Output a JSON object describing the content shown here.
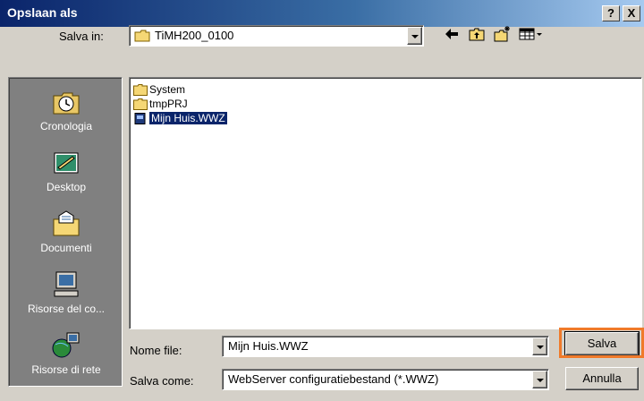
{
  "window": {
    "title": "Opslaan als",
    "help_button": "?",
    "close_button": "X"
  },
  "lookin": {
    "label": "Salva in:",
    "value": "TiMH200_0100"
  },
  "toolbar": {
    "icons": [
      "back-arrow-icon",
      "up-folder-icon",
      "new-folder-icon",
      "view-menu-icon"
    ]
  },
  "places": [
    {
      "label": "Cronologia",
      "icon": "history-icon"
    },
    {
      "label": "Desktop",
      "icon": "desktop-icon"
    },
    {
      "label": "Documenti",
      "icon": "documents-folder-icon"
    },
    {
      "label": "Risorse del co...",
      "icon": "my-computer-icon"
    },
    {
      "label": "Risorse di rete",
      "icon": "network-places-icon"
    }
  ],
  "files": [
    {
      "name": "System",
      "type": "folder",
      "selected": false
    },
    {
      "name": "tmpPRJ",
      "type": "folder",
      "selected": false
    },
    {
      "name": "Mijn Huis.WWZ",
      "type": "file",
      "selected": true
    }
  ],
  "filename": {
    "label": "Nome file:",
    "value": "Mijn Huis.WWZ"
  },
  "filetype": {
    "label": "Salva come:",
    "value": "WebServer configuratiebestand (*.WWZ)"
  },
  "buttons": {
    "save": "Salva",
    "cancel": "Annulla"
  },
  "colors": {
    "highlight": "#f07a2a",
    "selection": "#0a246a",
    "places_bg": "#808080"
  }
}
